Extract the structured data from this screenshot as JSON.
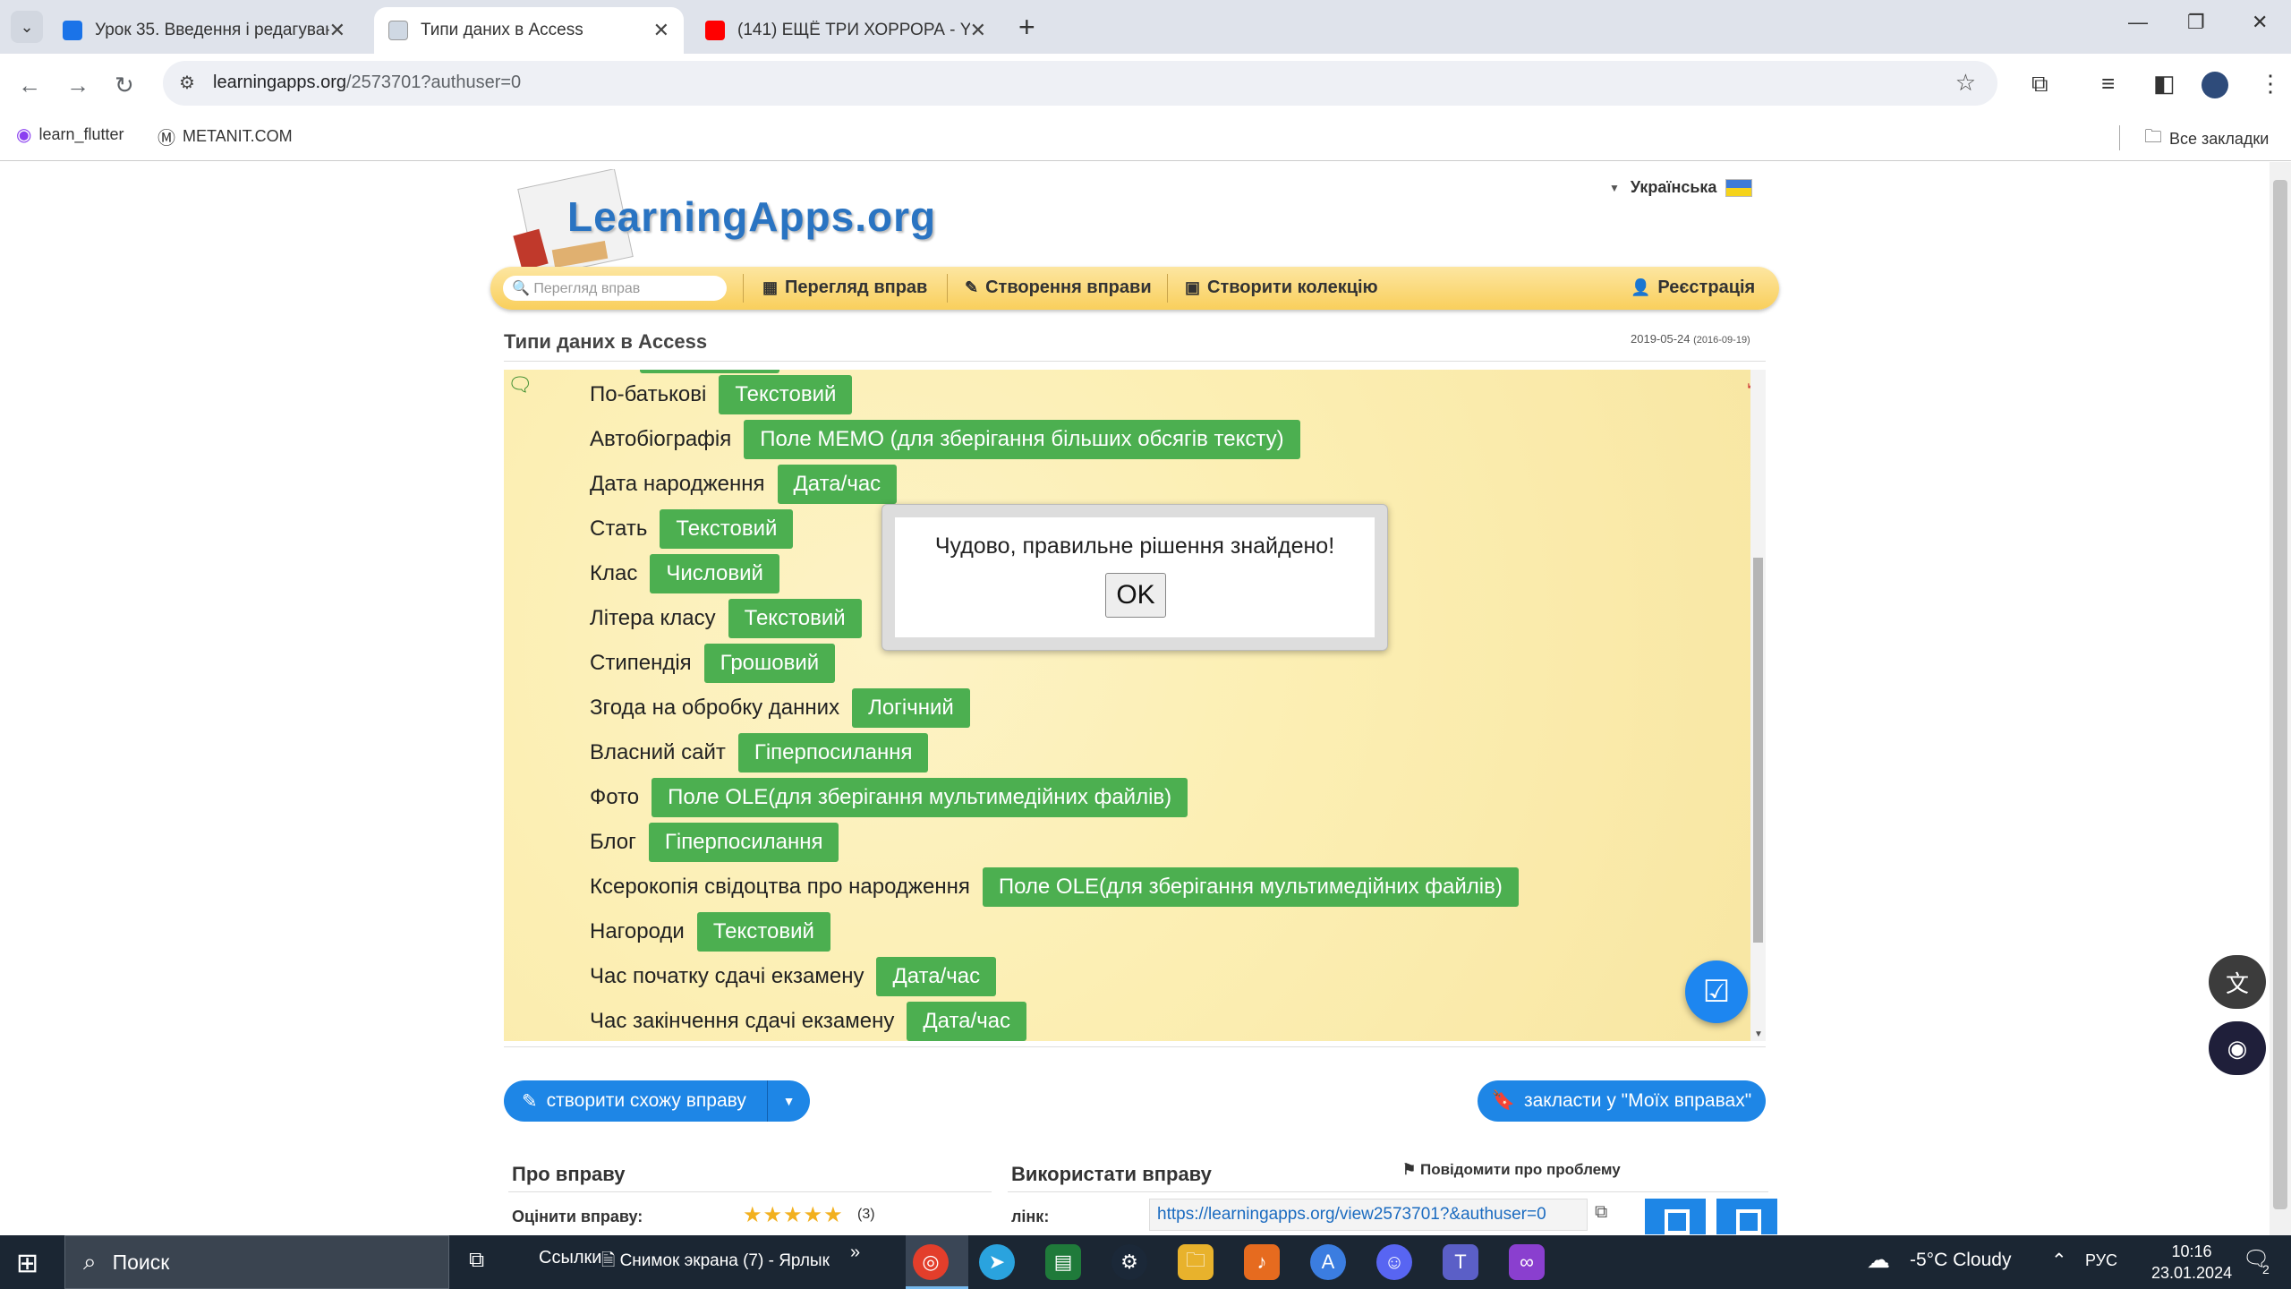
{
  "browser": {
    "tabs": [
      {
        "title": "Урок 35. Введення і редагування",
        "color": "#1a73e8"
      },
      {
        "title": "Типи даних в Access",
        "color": "#888888"
      },
      {
        "title": "(141) ЕЩЁ ТРИ ХОРРОРА - YouTube",
        "color": "#ff0000"
      }
    ],
    "url_host": "learningapps.org",
    "url_path": "/2573701?authuser=0",
    "bookmarks": [
      "learn_flutter",
      "METANIT.COM"
    ],
    "all_bookmarks": "Все закладки"
  },
  "site": {
    "language": "Українська",
    "logo": "LearningApps.org",
    "search_placeholder": "Перегляд вправ",
    "menu": {
      "browse": "Перегляд вправ",
      "create": "Створення вправи",
      "collection": "Створити колекцію",
      "register": "Реєстрація"
    }
  },
  "app": {
    "title": "Типи даних в Access",
    "date": "2019-05-24",
    "date_created": "(2016-09-19)",
    "rows": [
      {
        "label": "По-батькові",
        "type": "Текстовий"
      },
      {
        "label": "Автобіографія",
        "type": "Поле МЕМО (для зберігання більших обсягів тексту)"
      },
      {
        "label": "Дата народження",
        "type": "Дата/час"
      },
      {
        "label": "Стать",
        "type": "Текстовий"
      },
      {
        "label": "Клас",
        "type": "Числовий"
      },
      {
        "label": "Літера класу",
        "type": "Текстовий"
      },
      {
        "label": "Стипендія",
        "type": "Грошовий"
      },
      {
        "label": "Згода на обробку данних",
        "type": "Логічний"
      },
      {
        "label": "Власний сайт",
        "type": "Гіперпосилання"
      },
      {
        "label": "Фото",
        "type": "Поле OLE(для зберігання мультимедійних файлів)"
      },
      {
        "label": "Блог",
        "type": "Гіперпосилання"
      },
      {
        "label": "Ксерокопія свідоцтва про народження",
        "type": "Поле OLE(для зберігання мультимедійних файлів)"
      },
      {
        "label": "Нагороди",
        "type": "Текстовий"
      },
      {
        "label": "Час початку сдачі екзамену",
        "type": "Дата/час"
      },
      {
        "label": "Час закінчення сдачі екзамену",
        "type": "Дата/час"
      }
    ]
  },
  "dialog": {
    "message": "Чудово, правильне рішення знайдено!",
    "ok": "OK"
  },
  "actions": {
    "create_similar": "створити схожу вправу",
    "save_mine": "закласти у \"Моїх вправах\""
  },
  "about": {
    "heading": "Про вправу",
    "rate_label": "Оцінити вправу:",
    "rating": 5,
    "rating_count": "(3)"
  },
  "use": {
    "heading": "Використати вправу",
    "report": "Повідомити про проблему",
    "link_label": "лінк:",
    "link": "https://learningapps.org/view2573701?&authuser=0"
  },
  "taskbar": {
    "search": "Поиск",
    "links": "Ссылки",
    "pinned_file": "Снимок экрана (7) - Ярлык",
    "weather": "-5°C  Cloudy",
    "lang": "РУС",
    "time": "10:16",
    "date": "23.01.2024",
    "notifications": "2"
  }
}
